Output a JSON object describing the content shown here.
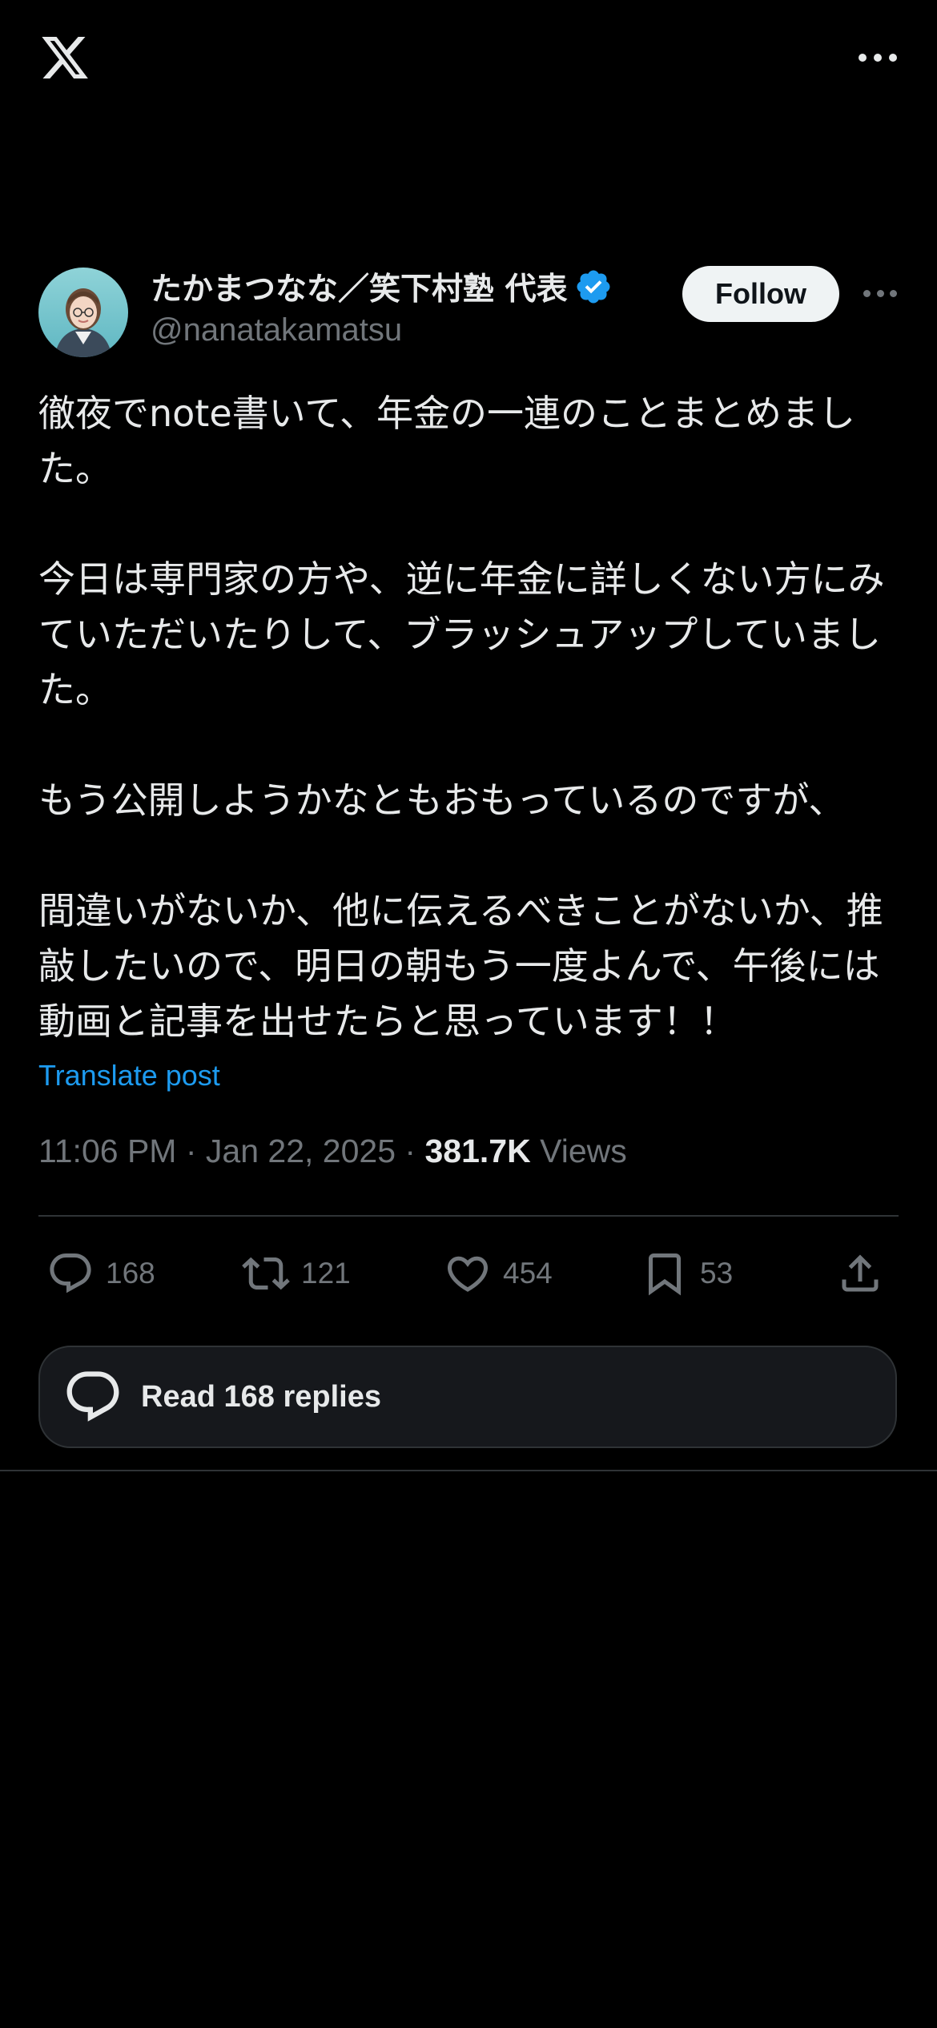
{
  "colors": {
    "background": "#000000",
    "text_primary": "#e7e9ea",
    "text_secondary": "#71767b",
    "link": "#1d9bf0",
    "verified": "#1d9bf0",
    "follow_button_bg": "#eff3f4",
    "divider": "#2f3336"
  },
  "topbar": {
    "logo_icon": "x-logo-icon",
    "more_icon": "more-horizontal-icon"
  },
  "author": {
    "display_name": "たかまつなな／笑下村塾 代表",
    "handle": "@nanatakamatsu",
    "verified": true,
    "verified_icon": "verified-badge-icon",
    "avatar_icon": "avatar"
  },
  "header": {
    "follow_label": "Follow",
    "more_icon": "more-horizontal-icon"
  },
  "post": {
    "paragraphs": [
      "徹夜でnote書いて、年金の一連のことまとめました。",
      "今日は専門家の方や、逆に年金に詳しくない方にみていただいたりして、ブラッシュアップしていました。",
      "もう公開しようかなともおもっているのですが、",
      "間違いがないか、他に伝えるべきことがないか、推敲したいので、明日の朝もう一度よんで、午後には動画と記事を出せたらと思っています！！"
    ],
    "translate_label": "Translate post",
    "time": "11:06 PM",
    "date": "Jan 22, 2025",
    "separator": "·",
    "views_count": "381.7K",
    "views_label": "Views"
  },
  "actions": {
    "reply": {
      "icon": "reply-icon",
      "count": "168"
    },
    "repost": {
      "icon": "repost-icon",
      "count": "121"
    },
    "like": {
      "icon": "heart-icon",
      "count": "454"
    },
    "bookmark": {
      "icon": "bookmark-icon",
      "count": "53"
    },
    "share": {
      "icon": "share-icon"
    }
  },
  "replies_button": {
    "icon": "reply-icon",
    "label": "Read 168 replies"
  }
}
